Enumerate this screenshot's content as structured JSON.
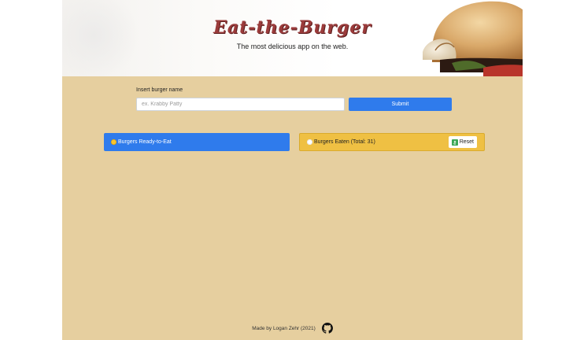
{
  "header": {
    "title": "Eat-the-Burger",
    "subtitle": "The most delicious app on the web."
  },
  "form": {
    "label": "Insert burger name",
    "input_placeholder": "ex. Krabby Patty",
    "input_value": "",
    "submit_label": "Submit"
  },
  "panels": {
    "ready": {
      "icon": "smiley-face-icon",
      "label": "Burgers Ready-to-Eat"
    },
    "eaten": {
      "icon": "plate-icon",
      "label": "Burgers Eaten (Total: 31)",
      "reset_icon": "recycle-icon",
      "reset_label": "Reset"
    }
  },
  "footer": {
    "text": "Made by Logan Zehr (2021)",
    "icon": "github-icon"
  },
  "colors": {
    "background": "#e6cf9f",
    "primary": "#2f7bec",
    "warning": "#efc043",
    "title": "#9b3b3b"
  }
}
